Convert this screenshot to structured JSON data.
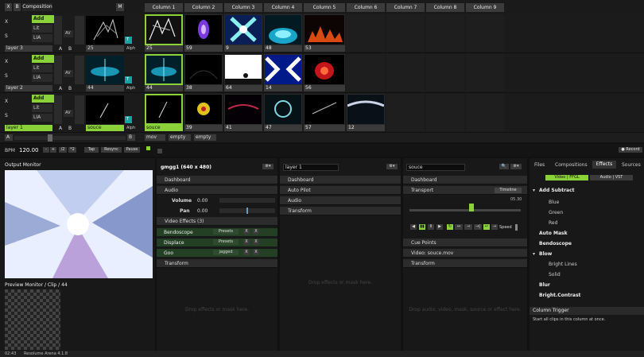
{
  "topbar": {
    "x": "X",
    "b": "B",
    "composition": "Composition",
    "m": "M"
  },
  "columns": [
    "Column 1",
    "Column 2",
    "Column 3",
    "Column 4",
    "Column 5",
    "Column 6",
    "Column 7",
    "Column 8",
    "Column 9"
  ],
  "layers": [
    {
      "name": "layer 3",
      "blend": "Add",
      "lit": "Lit",
      "lia": "LIA",
      "av": "AV",
      "alph": "Alph",
      "a": "A",
      "b": "B",
      "clip_value": "25",
      "clips": [
        "25",
        "59",
        "9",
        "48",
        "53"
      ]
    },
    {
      "name": "layer 2",
      "blend": "Add",
      "lit": "Lit",
      "lia": "LIA",
      "av": "AV",
      "alph": "Alph",
      "a": "A",
      "b": "B",
      "clip_value": "44",
      "clips": [
        "44",
        "38",
        "64",
        "14",
        "56"
      ]
    },
    {
      "name": "layer 1",
      "blend": "Add",
      "lit": "Lit",
      "lia": "LIA",
      "av": "AV",
      "alph": "Alph",
      "a": "A",
      "b": "B",
      "clip_value": "souce",
      "clips": [
        "souce",
        "39",
        "41",
        "47",
        "57",
        "12"
      ]
    }
  ],
  "deck": {
    "a": "A",
    "b": "B",
    "deck1": "mov",
    "deck2": "empty",
    "deck3": "empty"
  },
  "transport_bar": {
    "bpm_label": "BPM",
    "bpm": "120.00",
    "minus": "-",
    "plus": "+",
    "div2": "/2",
    "mul2": "*2",
    "tap": "Tap",
    "resync": "Resync",
    "pause": "Pause",
    "record": "● Record"
  },
  "output": {
    "title": "Output Monitor",
    "preview_title": "Preview Monitor / Clip / 44"
  },
  "comp_panel": {
    "title": "gmgg1 (640 x 480)",
    "dashboard": "Dashboard",
    "audio": "Audio",
    "volume_label": "Volume",
    "volume": "0.00",
    "pan_label": "Pan",
    "pan": "0.00",
    "video_effects": "Video Effects (3)",
    "effects": [
      {
        "name": "Bendoscope",
        "preset": "Presets"
      },
      {
        "name": "Displace",
        "preset": "Presets"
      },
      {
        "name": "Goo",
        "preset": "jagged"
      }
    ],
    "transform": "Transform",
    "drop": "Drop effects or mask here."
  },
  "layer_panel": {
    "name": "layer 1",
    "dashboard": "Dashboard",
    "autopilot": "Auto Pilot",
    "audio": "Audio",
    "transform": "Transform",
    "drop": "Drop effects or mask here."
  },
  "clip_panel": {
    "name": "souce",
    "dashboard": "Dashboard",
    "transport": "Transport",
    "timeline": "Timeline",
    "time": "05.30",
    "speed": "Speed",
    "cue": "Cue Points",
    "video": "Video: souce.mov",
    "transform": "Transform",
    "drop": "Drop audio, video, mask, source or effect here."
  },
  "browser": {
    "tabs": [
      "Files",
      "Compositions",
      "Effects",
      "Sources"
    ],
    "sub": [
      "Video | FFGL",
      "Audio | VST"
    ],
    "items": [
      {
        "t": "Add Subtract",
        "kind": "group"
      },
      {
        "t": "Blue",
        "kind": "sub"
      },
      {
        "t": "Green",
        "kind": "sub"
      },
      {
        "t": "Red",
        "kind": "sub"
      },
      {
        "t": "Auto Mask",
        "kind": "item"
      },
      {
        "t": "Bendoscope",
        "kind": "item"
      },
      {
        "t": "Blow",
        "kind": "group"
      },
      {
        "t": "Bright Lines",
        "kind": "sub"
      },
      {
        "t": "Solid",
        "kind": "sub"
      },
      {
        "t": "Blur",
        "kind": "item"
      },
      {
        "t": "Bright.Contrast",
        "kind": "item"
      }
    ],
    "trigger_title": "Column Trigger",
    "trigger_text": "Start all clips in this column at once."
  },
  "status": {
    "time": "02:43",
    "app": "Resolume Arena 4.1.8"
  },
  "colors": {
    "accent": "#8bd23a",
    "background": "#111111"
  }
}
